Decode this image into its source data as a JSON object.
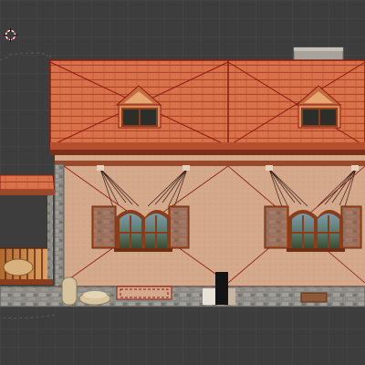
{
  "viewport": {
    "background": "#3d3d3d",
    "grid_color": "#474747",
    "cursor_icon": "3d-cursor-icon"
  },
  "scene": {
    "object": "house-model",
    "wire_color": "#8b1a10",
    "colors": {
      "roof_tile": "#d9714a",
      "roof_dark": "#b4502d",
      "wall_stucco": "#d4a88a",
      "stone": "#8c8a84",
      "window_frame": "#8a3d1c",
      "glass": "#5f7f8a",
      "chimney": "#a7a29b"
    }
  }
}
